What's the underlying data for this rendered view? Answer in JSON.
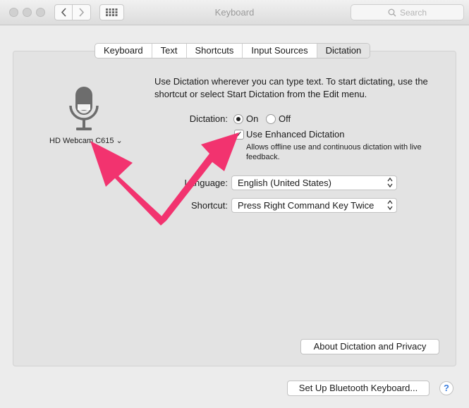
{
  "window": {
    "title": "Keyboard",
    "search_placeholder": "Search"
  },
  "tabs": [
    {
      "label": "Keyboard",
      "active": false
    },
    {
      "label": "Text",
      "active": false
    },
    {
      "label": "Shortcuts",
      "active": false
    },
    {
      "label": "Input Sources",
      "active": false
    },
    {
      "label": "Dictation",
      "active": true
    }
  ],
  "dictation": {
    "mic_source": "HD Webcam C615 ⌄",
    "description": "Use Dictation wherever you can type text. To start dictating, use the shortcut or select Start Dictation from the Edit menu.",
    "label": "Dictation:",
    "option_on": "On",
    "option_off": "Off",
    "selected": "On",
    "enhanced_label": "Use Enhanced Dictation",
    "enhanced_checked": true,
    "enhanced_help": "Allows offline use and continuous dictation with live feedback.",
    "language_label": "Language:",
    "language_value": "English (United States)",
    "shortcut_label": "Shortcut:",
    "shortcut_value": "Press Right Command Key Twice",
    "about_button": "About Dictation and Privacy"
  },
  "footer": {
    "bluetooth_button": "Set Up Bluetooth Keyboard...",
    "help_button": "?"
  },
  "colors": {
    "annotation_arrow": "#f2336f"
  }
}
